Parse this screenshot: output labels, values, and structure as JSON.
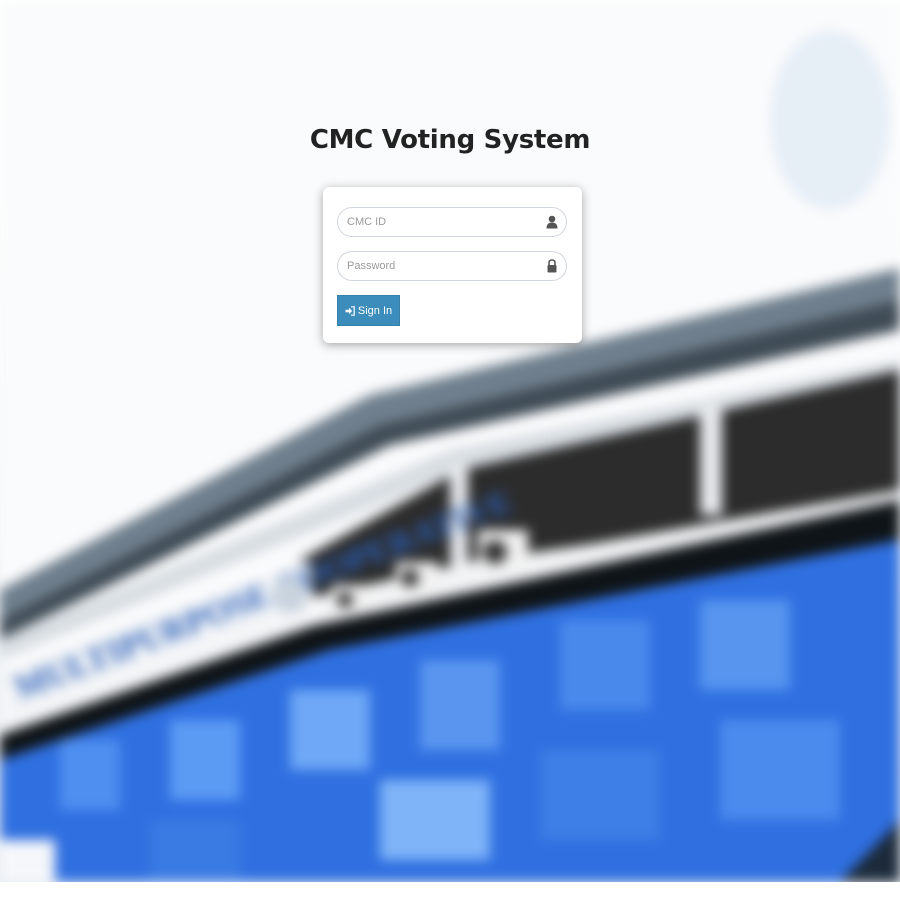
{
  "page": {
    "title": "CMC Voting System"
  },
  "login": {
    "id_placeholder": "CMC ID",
    "id_value": "",
    "id_icon": "user-icon",
    "password_placeholder": "Password",
    "password_value": "",
    "password_icon": "lock-icon",
    "signin_label": "Sign In",
    "signin_icon": "sign-in-icon"
  },
  "background": {
    "sign_text": "MULTIPURPOSE COOPERATIVE",
    "sky_color": "#ffffff",
    "glass_color": "#2f6fe0",
    "button_color": "#3c8dbc"
  }
}
